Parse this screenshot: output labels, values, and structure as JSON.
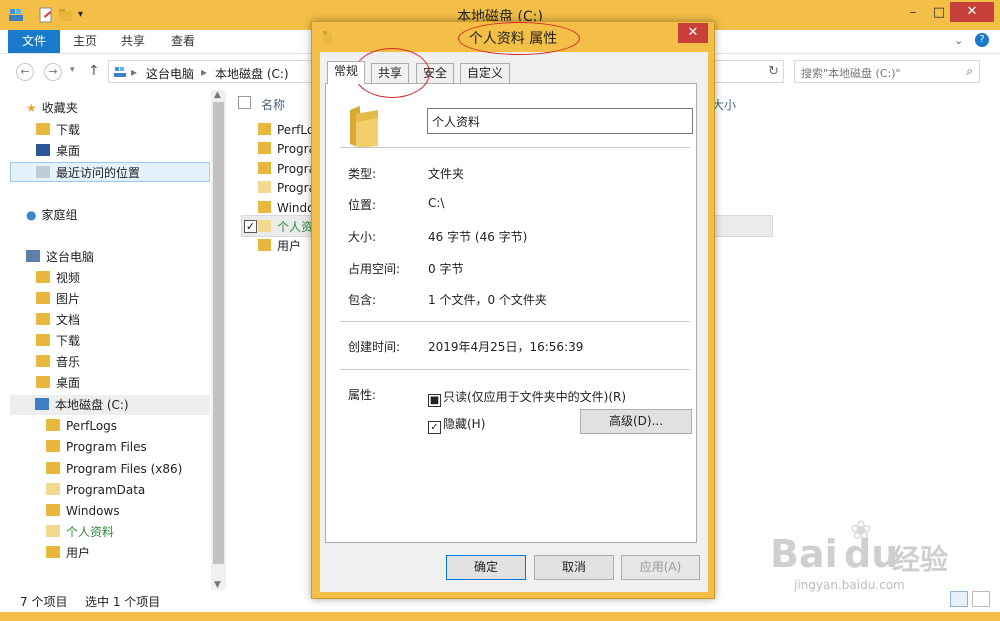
{
  "explorer": {
    "title": "本地磁盘 (C:)",
    "ribbon_tabs": {
      "file": "文件",
      "home": "主页",
      "share": "共享",
      "view": "查看"
    },
    "address": {
      "this_pc": "这台电脑",
      "sep": "▸",
      "drive": "本地磁盘 (C:)"
    },
    "search_placeholder": "搜索\"本地磁盘 (C:)\"",
    "column_name": "名称",
    "column_size": "大小",
    "nav": {
      "favorites": "收藏夹",
      "downloads": "下载",
      "desktop": "桌面",
      "recent": "最近访问的位置",
      "homegroup": "家庭组",
      "this_pc": "这台电脑",
      "videos": "视频",
      "pictures": "图片",
      "documents": "文档",
      "downloads2": "下载",
      "music": "音乐",
      "desktop2": "桌面",
      "drive": "本地磁盘 (C:)",
      "perflogs": "PerfLogs",
      "program_files": "Program Files",
      "program_files_x86": "Program Files (x86)",
      "programdata": "ProgramData",
      "windows": "Windows",
      "personal": "个人资料",
      "users": "用户"
    },
    "files": {
      "f1": "PerfLo",
      "f2": "Progra",
      "f3": "Progra",
      "f4": "Progra",
      "f5": "Windo",
      "f6": "个人资",
      "f7": "用户"
    },
    "status": {
      "count": "7 个项目",
      "selected": "选中 1 个项目"
    }
  },
  "dialog": {
    "title": "个人资料 属性",
    "tabs": {
      "general": "常规",
      "sharing": "共享",
      "security": "安全",
      "custom": "自定义"
    },
    "name": "个人资料",
    "rows": {
      "type_label": "类型:",
      "type_value": "文件夹",
      "location_label": "位置:",
      "location_value": "C:\\",
      "size_label": "大小:",
      "size_value": "46 字节 (46 字节)",
      "disk_label": "占用空间:",
      "disk_value": "0 字节",
      "contains_label": "包含:",
      "contains_value": "1 个文件，0 个文件夹",
      "created_label": "创建时间:",
      "created_value": "2019年4月25日，16:56:39",
      "attr_label": "属性:"
    },
    "attrs": {
      "readonly": "只读(仅应用于文件夹中的文件)(R)",
      "hidden": "隐藏(H)",
      "advanced": "高级(D)..."
    },
    "buttons": {
      "ok": "确定",
      "cancel": "取消",
      "apply": "应用(A)"
    }
  },
  "watermark": {
    "brand": "Bai",
    "brand2": "du",
    "brand_cn": "经验",
    "url": "jingyan.baidu.com"
  },
  "colors": {
    "frame": "#f3bf47",
    "accent": "#1979ca",
    "annotation": "#d7282a"
  }
}
